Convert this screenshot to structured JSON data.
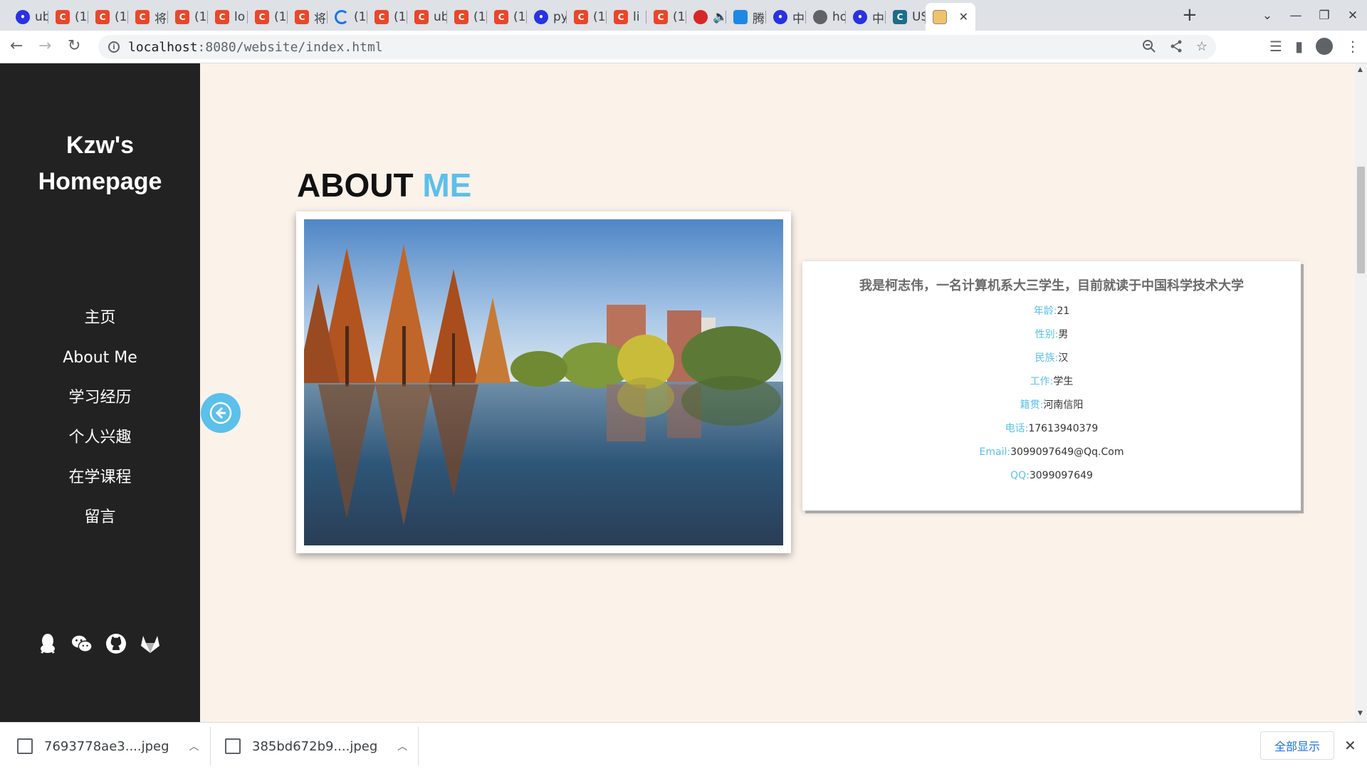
{
  "browser": {
    "tabs": [
      {
        "icon": "baidu-icon",
        "label": "ub"
      },
      {
        "icon": "c-icon",
        "label": "(1"
      },
      {
        "icon": "c-icon",
        "label": "(1"
      },
      {
        "icon": "c-icon",
        "label": "将"
      },
      {
        "icon": "c-icon",
        "label": "(1"
      },
      {
        "icon": "c-icon",
        "label": "lo"
      },
      {
        "icon": "c-icon",
        "label": "(1"
      },
      {
        "icon": "c-icon",
        "label": "将"
      },
      {
        "icon": "loading-icon",
        "label": "(1"
      },
      {
        "icon": "c-icon",
        "label": "(1"
      },
      {
        "icon": "c-icon",
        "label": "ub"
      },
      {
        "icon": "c-icon",
        "label": "(1"
      },
      {
        "icon": "c-icon",
        "label": "(1"
      },
      {
        "icon": "baidu-icon",
        "label": "py"
      },
      {
        "icon": "c-icon",
        "label": "(1"
      },
      {
        "icon": "c-icon",
        "label": "li"
      },
      {
        "icon": "c-icon",
        "label": "(1"
      },
      {
        "icon": "netease-icon",
        "label": "🔈"
      },
      {
        "icon": "tencent-icon",
        "label": "腾"
      },
      {
        "icon": "baidu-icon",
        "label": "中"
      },
      {
        "icon": "globe-icon",
        "label": "ho"
      },
      {
        "icon": "baidu-icon",
        "label": "中"
      },
      {
        "icon": "us-icon",
        "label": "US"
      },
      {
        "icon": "image-icon",
        "label": ""
      }
    ],
    "url_host": "localhost",
    "url_rest": ":8080/website/index.html"
  },
  "site": {
    "title_line1": "Kzw's",
    "title_line2": "Homepage",
    "nav": [
      "主页",
      "About Me",
      "学习经历",
      "个人兴趣",
      "在学课程",
      "留言"
    ]
  },
  "about": {
    "heading_main": "ABOUT",
    "heading_accent": "ME",
    "intro": "我是柯志伟，一名计算机系大三学生，目前就读于中国科学技术大学",
    "fields": [
      {
        "key": "年龄:",
        "value": "21"
      },
      {
        "key": "性别:",
        "value": "男"
      },
      {
        "key": "民族:",
        "value": "汉"
      },
      {
        "key": "工作:",
        "value": "学生"
      },
      {
        "key": "籍贯:",
        "value": "河南信阳"
      },
      {
        "key": "电话:",
        "value": "17613940379"
      },
      {
        "key": "Email:",
        "value": "3099097649@Qq.Com"
      },
      {
        "key": "QQ:",
        "value": "3099097649"
      }
    ]
  },
  "downloads": {
    "items": [
      "7693778ae3....jpeg",
      "385bd672b9....jpeg"
    ],
    "show_all": "全部显示"
  },
  "colors": {
    "accent": "#5bc0eb",
    "sidebar": "#222222",
    "page_bg": "#fbf2ea"
  }
}
